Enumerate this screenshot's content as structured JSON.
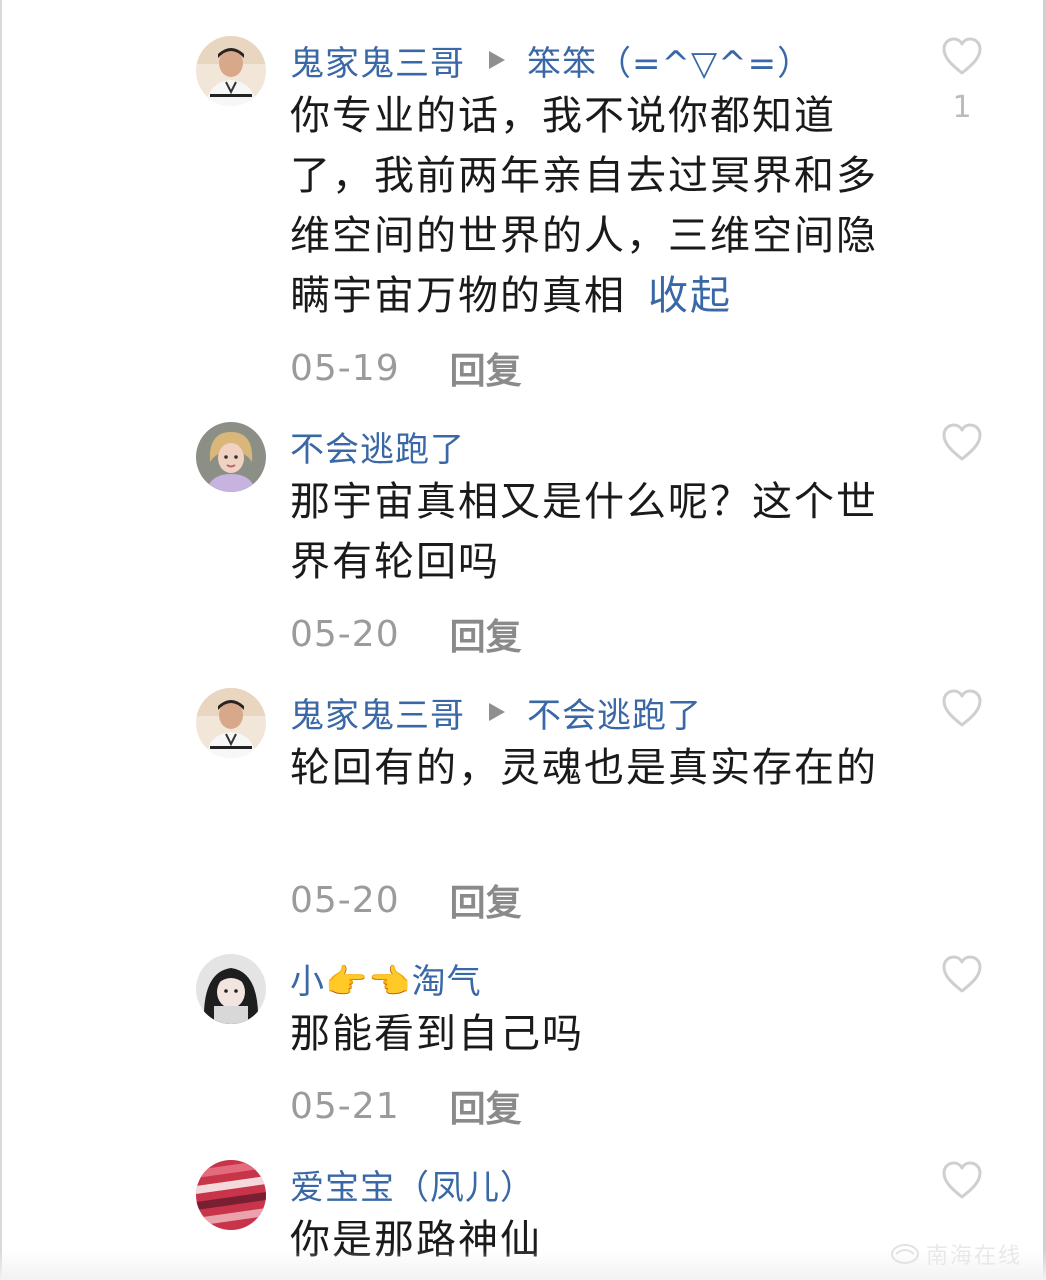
{
  "comments": [
    {
      "author": "鬼家鬼三哥",
      "reply_to": "笨笨（=^▽^=）",
      "text": "你专业的话，我不说你都知道了，我前两年亲自去过冥界和多维空间的世界的人，三维空间隐瞒宇宙万物的真相",
      "expand_label": "收起",
      "date": "05-19",
      "reply_label": "回复",
      "like_count": "1",
      "avatar": "man-avatar"
    },
    {
      "author": "不会逃跑了",
      "text": "那宇宙真相又是什么呢？这个世界有轮回吗",
      "date": "05-20",
      "reply_label": "回复",
      "avatar": "woman-avatar"
    },
    {
      "author": "鬼家鬼三哥",
      "reply_to": "不会逃跑了",
      "text": "轮回有的，灵魂也是真实存在的",
      "date": "05-20",
      "reply_label": "回复",
      "avatar": "man-avatar"
    },
    {
      "author": "小👉👈淘气",
      "text": "那能看到自己吗",
      "date": "05-21",
      "reply_label": "回复",
      "avatar": "girl-avatar"
    },
    {
      "author": "爱宝宝（凤儿）",
      "text": "你是那路神仙",
      "avatar": "pattern-avatar"
    }
  ],
  "watermark": "南海在线",
  "colors": {
    "link": "#3a68a6",
    "text": "#1a1a1a",
    "meta": "#9b9b9b",
    "icon": "#cfcfcf"
  }
}
